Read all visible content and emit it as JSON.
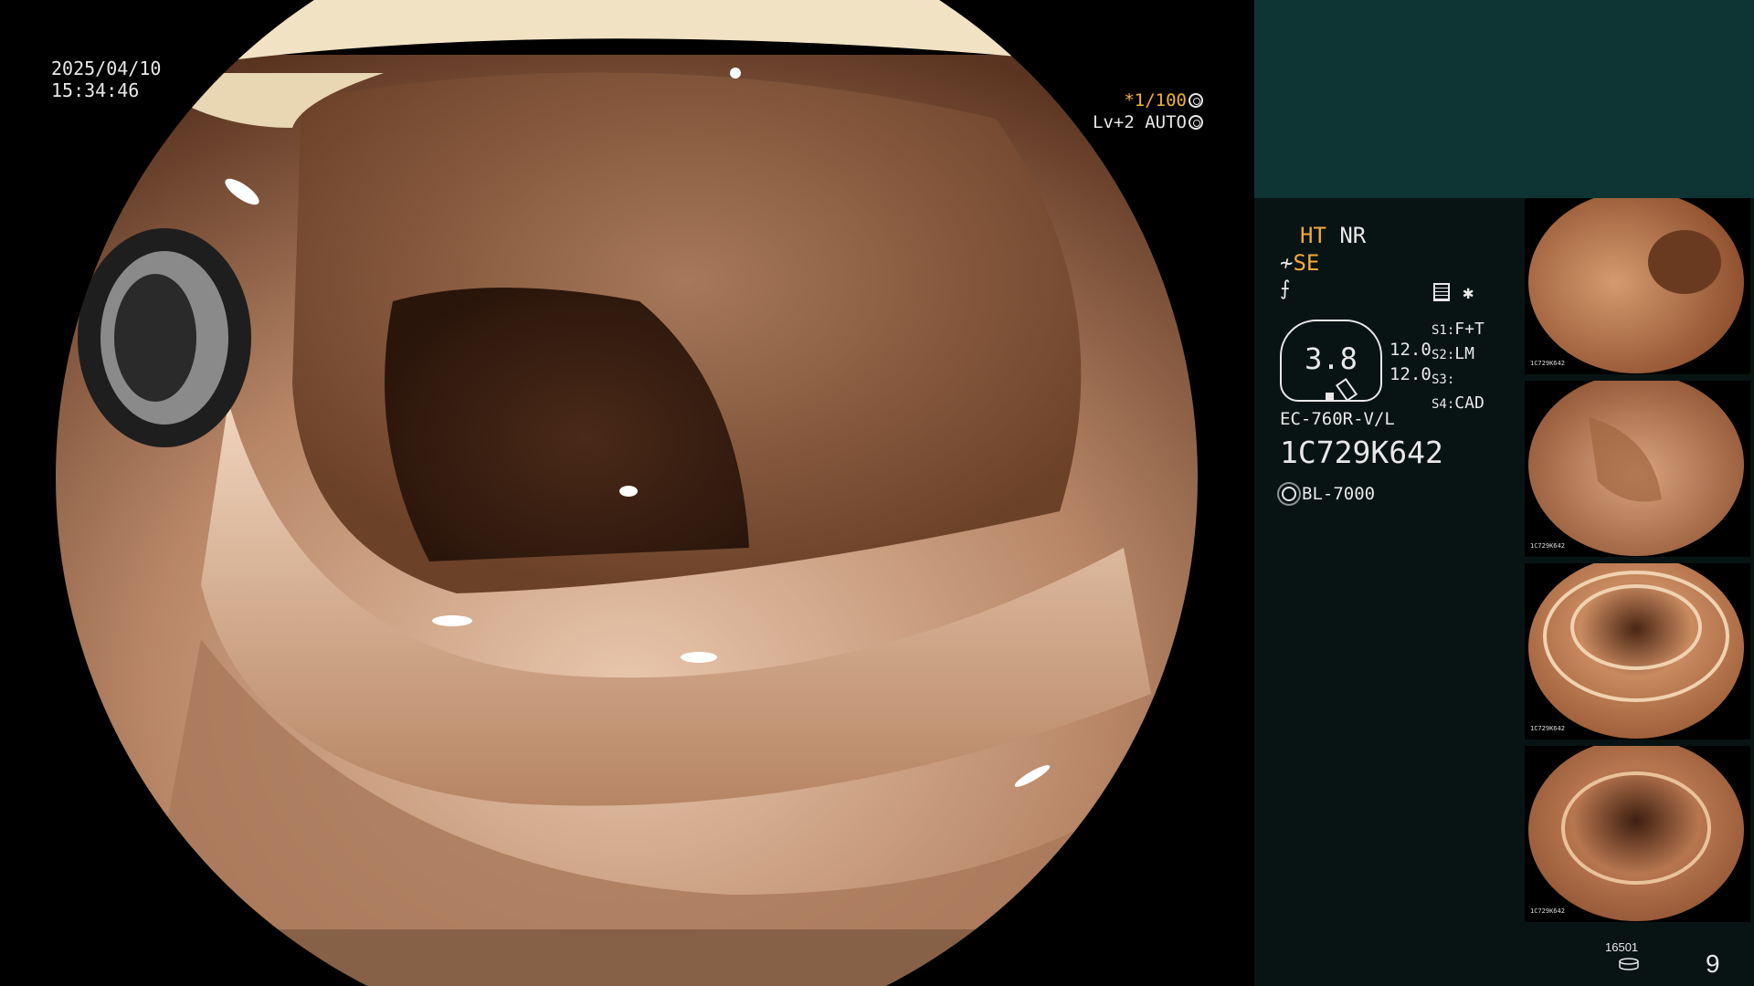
{
  "overlay": {
    "date": "2025/04/10",
    "time": "15:34:46",
    "shutter": "*1/100",
    "level": "Lv+2 AUTO"
  },
  "panel": {
    "mode_ht": "HT",
    "mode_nr": "NR",
    "se": "SE",
    "zoom": "3.8",
    "zoom_a": "12.0",
    "zoom_b": "12.0",
    "scenes": [
      {
        "key": "S1:",
        "value": "F+T"
      },
      {
        "key": "S2:",
        "value": "LM"
      },
      {
        "key": "S3:",
        "value": ""
      },
      {
        "key": "S4:",
        "value": "CAD"
      }
    ],
    "scope_model": "EC-760R-V/L",
    "serial": "1C729K642",
    "light_source": "BL-7000",
    "image_count": "16501",
    "page": "9"
  },
  "thumbnails": [
    {
      "caption": "1C729K642"
    },
    {
      "caption": "1C729K642"
    },
    {
      "caption": "1C729K642"
    },
    {
      "caption": "1C729K642"
    }
  ],
  "colors": {
    "panel_bg": "#081414",
    "panel_top": "#0e3434",
    "accent": "#f3a93d",
    "mucosa": "#c89a78"
  }
}
